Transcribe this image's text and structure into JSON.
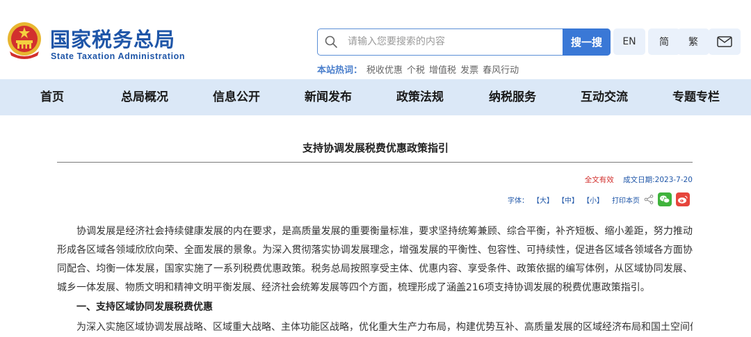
{
  "header": {
    "site_name_cn": "国家税务总局",
    "site_name_en": "State Taxation Administration",
    "search": {
      "placeholder": "请输入您要搜索的内容",
      "button_label": "搜一搜"
    },
    "lang": {
      "en": "EN",
      "simplified": "简",
      "traditional": "繁"
    },
    "hotwords": {
      "label": "本站热词：",
      "items": [
        "税收优惠",
        "个税",
        "增值税",
        "发票",
        "春风行动"
      ]
    }
  },
  "nav": {
    "items": [
      "首页",
      "总局概况",
      "信息公开",
      "新闻发布",
      "政策法规",
      "纳税服务",
      "互动交流",
      "专题专栏"
    ]
  },
  "article": {
    "title": "支持协调发展税费优惠政策指引",
    "validity": "全文有效",
    "date": "成文日期:2023-7-20",
    "tools": {
      "font_label": "字体：",
      "large": "【大】",
      "medium": "【中】",
      "small": "【小】",
      "print": "打印本页"
    },
    "paragraph": "协调发展是经济社会持续健康发展的内在要求，是高质量发展的重要衡量标准，要求坚持统筹兼顾、综合平衡，补齐短板、缩小差距，努力推动形成各区域各领域欣欣向荣、全面发展的景象。为深入贯彻落实协调发展理念，增强发展的平衡性、包容性、可持续性，促进各区域各领域各方面协同配合、均衡一体发展，国家实施了一系列税费优惠政策。税务总局按照享受主体、优惠内容、享受条件、政策依据的编写体例，从区域协同发展、城乡一体发展、物质文明和精神文明平衡发展、经济社会统筹发展等四个方面，梳理形成了涵盖216项支持协调发展的税费优惠政策指引。",
    "section_heading": "一、支持区域协同发展税费优惠",
    "cut_line": "为深入实施区域协调发展战略、区域重大战略、主体功能区战略，优化重大生产力布局，构建优势互补、高质量发展的区域经济布局和国土空间体"
  },
  "colors": {
    "brand_blue": "#1f56a8",
    "nav_bg": "#dbe8f7",
    "button_blue": "#3a78d6",
    "valid_red": "#d2302e"
  }
}
